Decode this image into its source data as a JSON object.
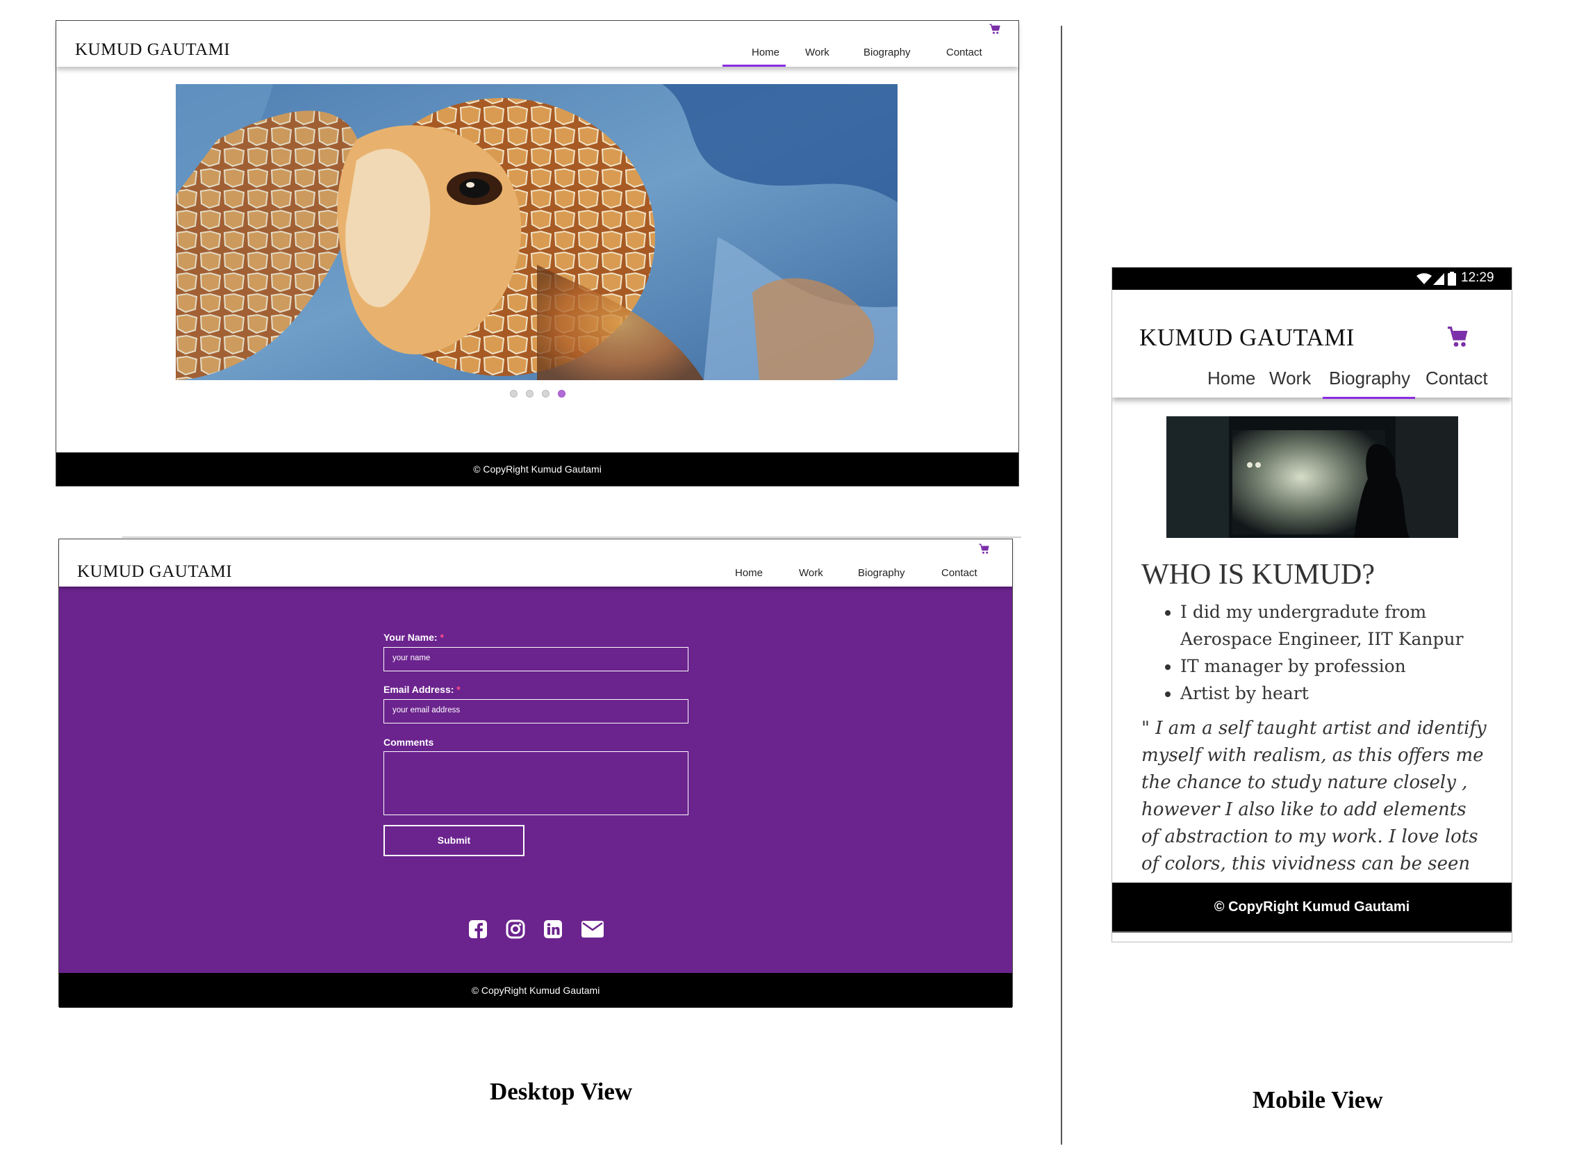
{
  "desktop_home": {
    "brand": "KUMUD GAUTAMI",
    "nav": [
      "Home",
      "Work",
      "Biography",
      "Contact"
    ],
    "active_nav": "Home",
    "carousel_slide": 4,
    "carousel_total": 4,
    "footer": "© CopyRight Kumud Gautami"
  },
  "desktop_contact": {
    "brand": "KUMUD GAUTAMI",
    "nav": [
      "Home",
      "Work",
      "Biography",
      "Contact"
    ],
    "form": {
      "name_label": "Your Name:",
      "name_placeholder": "your name",
      "email_label": "Email Address:",
      "email_placeholder": "your email address",
      "comments_label": "Comments",
      "required_mark": "*",
      "submit_label": "Submit"
    },
    "social_icons": [
      "facebook-icon",
      "instagram-icon",
      "linkedin-icon",
      "envelope-icon"
    ],
    "footer": "© CopyRight Kumud Gautami"
  },
  "mobile_biography": {
    "status_time": "12:29",
    "brand": "KUMUD GAUTAMI",
    "nav": [
      "Home",
      "Work",
      "Biography",
      "Contact"
    ],
    "active_nav": "Biography",
    "heading": "WHO IS KUMUD?",
    "bullets": [
      "I did my undergradute from Aerospace Engineer, IIT Kanpur",
      "IT manager by profession",
      "Artist by heart"
    ],
    "quote": "\" I am a self taught artist and identify myself with realism, as this offers me the chance to study nature closely , however I also like to add elements of abstraction to my work. I love lots of colors, this vividness can be seen in my",
    "footer": "© CopyRight Kumud Gautami"
  },
  "captions": {
    "desktop": "Desktop View",
    "mobile": "Mobile View"
  },
  "colors": {
    "accent_purple": "#6b238e",
    "active_underline": "#8a2be2",
    "cart": "#7b2fa8",
    "footer": "#000000"
  }
}
